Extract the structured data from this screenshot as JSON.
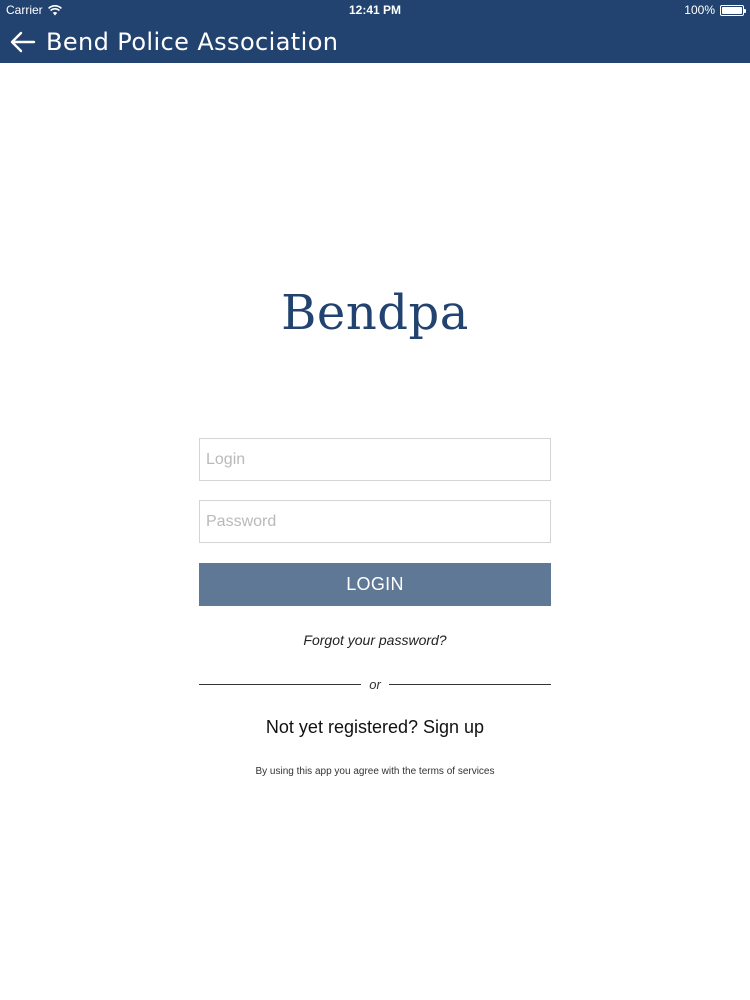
{
  "status_bar": {
    "carrier": "Carrier",
    "time": "12:41 PM",
    "battery": "100%"
  },
  "nav": {
    "back_icon": "arrow-left-icon",
    "title": "Bend Police Association"
  },
  "brand": {
    "name": "Bendpa"
  },
  "form": {
    "login_placeholder": "Login",
    "login_value": "",
    "password_placeholder": "Password",
    "password_value": "",
    "login_button_label": "LOGIN",
    "forgot_password_label": "Forgot your password?",
    "divider_label": "or",
    "signup_label": "Not yet registered? Sign up",
    "terms_text": "By using this app you agree with the terms of services"
  },
  "colors": {
    "nav_background": "#22436f",
    "brand_text": "#22436f",
    "login_button": "#5f7896"
  }
}
